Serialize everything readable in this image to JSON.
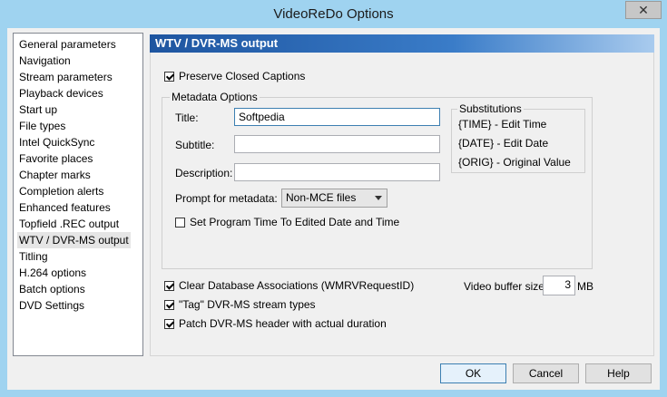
{
  "window": {
    "title": "VideoReDo Options"
  },
  "nav": {
    "items": [
      "General parameters",
      "Navigation",
      "Stream parameters",
      "Playback devices",
      "Start up",
      "File types",
      "Intel QuickSync",
      "Favorite places",
      "Chapter marks",
      "Completion alerts",
      "Enhanced features",
      "Topfield .REC output",
      "WTV / DVR-MS output",
      "Titling",
      "H.264 options",
      "Batch options",
      "DVD Settings"
    ],
    "selected": "WTV / DVR-MS output"
  },
  "panel": {
    "header": "WTV / DVR-MS output",
    "preserve_cc": {
      "label": "Preserve Closed Captions",
      "checked": true
    },
    "metadata": {
      "legend": "Metadata Options",
      "title_label": "Title:",
      "title_value": "Softpedia",
      "subtitle_label": "Subtitle:",
      "subtitle_value": "",
      "description_label": "Description:",
      "description_value": "",
      "prompt_label": "Prompt for metadata:",
      "prompt_value": "Non-MCE files",
      "set_time": {
        "label": "Set Program Time To Edited Date and Time",
        "checked": false
      }
    },
    "substitutions": {
      "legend": "Substitutions",
      "lines": [
        "{TIME} - Edit Time",
        "{DATE} - Edit Date",
        "{ORIG} - Original Value"
      ]
    },
    "clear_db": {
      "label": "Clear Database Associations (WMRVRequestID)",
      "checked": true
    },
    "buffer": {
      "label": "Video buffer size:",
      "value": "3",
      "unit": "MB"
    },
    "tag_types": {
      "label": "\"Tag\" DVR-MS stream types",
      "checked": true
    },
    "patch_header": {
      "label": "Patch DVR-MS header with actual duration",
      "checked": true
    }
  },
  "buttons": {
    "ok": "OK",
    "cancel": "Cancel",
    "help": "Help"
  }
}
